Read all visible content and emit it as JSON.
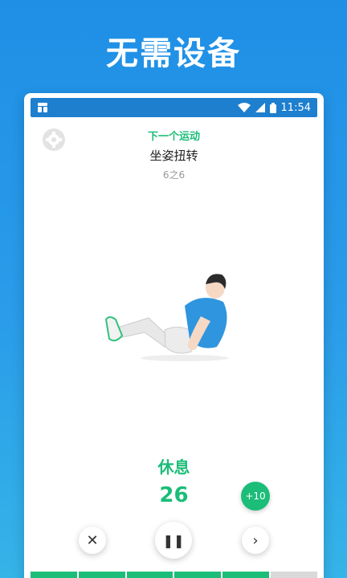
{
  "hero": {
    "title": "无需设备"
  },
  "statusbar": {
    "time": "11:54"
  },
  "workout": {
    "next_label": "下一个运动",
    "exercise_name": "坐姿扭转",
    "progress": "6之6",
    "rest_label": "休息",
    "countdown": "26",
    "add_time_label": "+10"
  },
  "controls": {
    "close_symbol": "✕",
    "pause_symbol": "❚❚",
    "next_symbol": "›"
  },
  "segments": {
    "completed": 5,
    "total": 6
  },
  "colors": {
    "accent": "#1bbd78",
    "brand": "#1e7fcf",
    "bg_top": "#1f8fe6"
  }
}
